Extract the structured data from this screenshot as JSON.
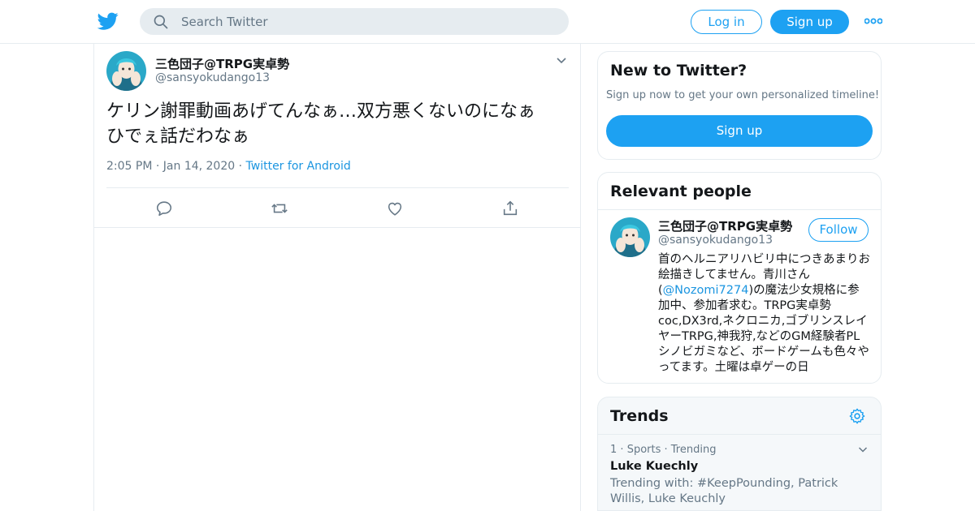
{
  "header": {
    "search_placeholder": "Search Twitter",
    "login_label": "Log in",
    "signup_label": "Sign up",
    "logo_icon": "twitter-bird-icon",
    "more_icon": "more-dots-icon"
  },
  "tweet": {
    "name": "三色団子@TRPG実卓勢",
    "handle": "@sansyokudango13",
    "text_line1": "ケリン謝罪動画あげてんなぁ…双方悪くないのになぁ",
    "text_line2": "ひでぇ話だわなぁ",
    "time": "2:05 PM",
    "date": "Jan 14, 2020",
    "source": "Twitter for Android",
    "actions": [
      "reply-icon",
      "retweet-icon",
      "like-icon",
      "share-icon"
    ]
  },
  "new_to_twitter": {
    "title": "New to Twitter?",
    "subtitle": "Sign up now to get your own personalized timeline!",
    "button": "Sign up"
  },
  "relevant_people": {
    "title": "Relevant people",
    "name": "三色団子@TRPG実卓勢",
    "handle": "@sansyokudango13",
    "follow_label": "Follow",
    "bio_before": "首のヘルニアリハビリ中につきあまりお絵描きしてません。青川さん(",
    "bio_mention": "@Nozomi7274",
    "bio_after": ")の魔法少女規格に参加中、参加者求む。TRPG実卓勢coc,DX3rd,ネクロニカ,ゴブリンスレイヤーTRPG,神我狩,などのGM経験者PLシノビガミなど、ボードゲームも色々やってます。土曜は卓ゲーの日"
  },
  "trends": {
    "title": "Trends",
    "items": [
      {
        "rank": "1",
        "category": "Sports",
        "status": "Trending",
        "name": "Luke Kuechly",
        "with": "Trending with: #KeepPounding, Patrick Willis, Luke Keuchly"
      }
    ]
  },
  "colors": {
    "accent": "#1da1f2",
    "link": "#1b95e0",
    "muted": "#657786",
    "border": "#e6ecf0"
  }
}
